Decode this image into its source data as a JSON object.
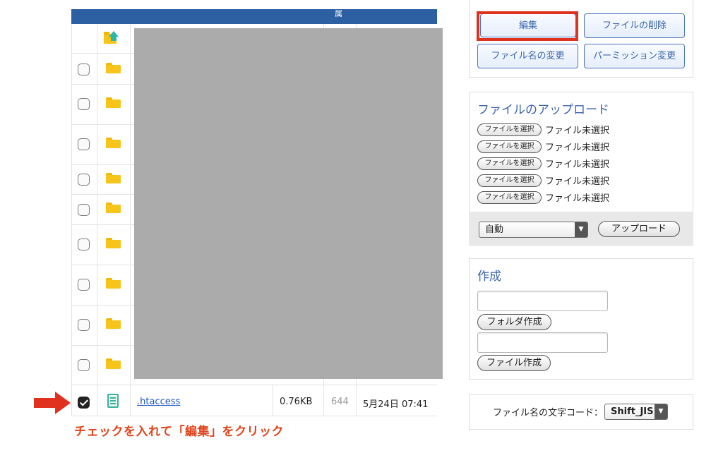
{
  "table": {
    "header_text": "属",
    "file_row": {
      "name": ".htaccess",
      "size": "0.76KB",
      "permission": "644",
      "date": "5月24日 07:41"
    }
  },
  "annotation": {
    "instruction": "チェックを入れて「編集」をクリック",
    "color": "#e0441c"
  },
  "actions": {
    "edit": "編集",
    "delete": "ファイルの削除",
    "rename": "ファイル名の変更",
    "permission": "パーミッション変更"
  },
  "upload": {
    "title": "ファイルのアップロード",
    "choose_button": "ファイルを選択",
    "no_file": "ファイル未選択",
    "mode": "自動",
    "submit": "アップロード"
  },
  "create": {
    "title": "作成",
    "folder_button": "フォルダ作成",
    "file_button": "ファイル作成"
  },
  "encoding": {
    "label": "ファイル名の文字コード：",
    "value": "Shift_JIS"
  },
  "colors": {
    "header_bg": "#2d5fa3",
    "accent": "#3b64ad",
    "highlight": "#e0301e"
  }
}
